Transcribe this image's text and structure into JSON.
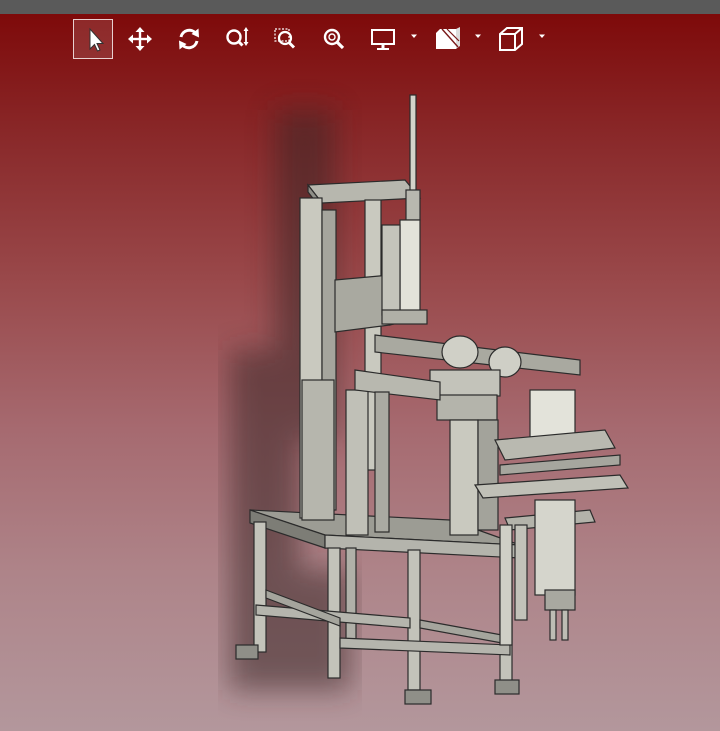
{
  "viewport": {
    "background_top": "#7e0a0a",
    "background_bottom": "#b3979c"
  },
  "toolbar": {
    "icon_color": "#ffffff",
    "tools": [
      {
        "name": "select-tool",
        "icon": "arrow-pointer-icon",
        "active": true
      },
      {
        "name": "pan-tool",
        "icon": "move-arrows-icon",
        "active": false
      },
      {
        "name": "rotate-tool",
        "icon": "rotate-icon",
        "active": false
      },
      {
        "name": "zoom-dynamic-tool",
        "icon": "zoom-updown-icon",
        "active": false
      },
      {
        "name": "zoom-window-tool",
        "icon": "zoom-box-icon",
        "active": false
      },
      {
        "name": "zoom-tool",
        "icon": "zoom-icon",
        "active": false
      },
      {
        "name": "display-mode-tool",
        "icon": "monitor-icon",
        "active": false,
        "dropdown": true
      },
      {
        "name": "section-view-tool",
        "icon": "section-cube-icon",
        "active": false,
        "dropdown": true
      },
      {
        "name": "view-orientation-tool",
        "icon": "cube-icon",
        "active": false,
        "dropdown": true
      }
    ]
  },
  "model": {
    "description_icon": "machine-assembly-3d-model",
    "metal_color": "#b9b9b0",
    "shadow_color": "#3a2626"
  }
}
